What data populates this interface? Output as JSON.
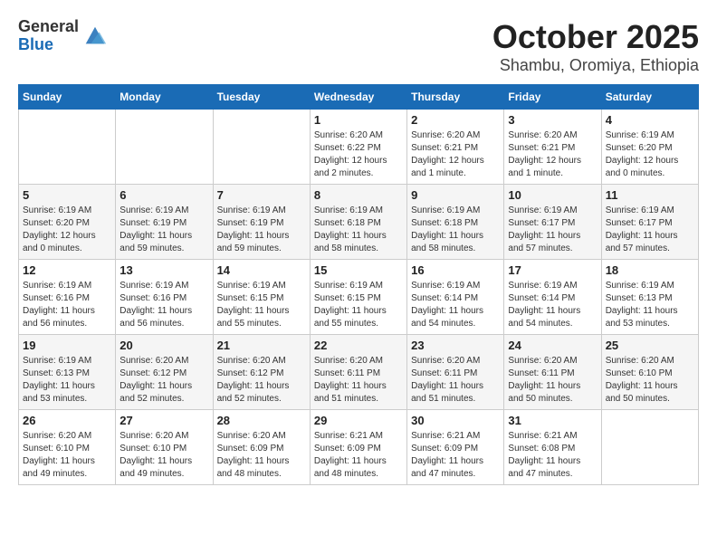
{
  "header": {
    "logo_general": "General",
    "logo_blue": "Blue",
    "month": "October 2025",
    "location": "Shambu, Oromiya, Ethiopia"
  },
  "weekdays": [
    "Sunday",
    "Monday",
    "Tuesday",
    "Wednesday",
    "Thursday",
    "Friday",
    "Saturday"
  ],
  "weeks": [
    [
      {
        "day": "",
        "info": ""
      },
      {
        "day": "",
        "info": ""
      },
      {
        "day": "",
        "info": ""
      },
      {
        "day": "1",
        "info": "Sunrise: 6:20 AM\nSunset: 6:22 PM\nDaylight: 12 hours and 2 minutes."
      },
      {
        "day": "2",
        "info": "Sunrise: 6:20 AM\nSunset: 6:21 PM\nDaylight: 12 hours and 1 minute."
      },
      {
        "day": "3",
        "info": "Sunrise: 6:20 AM\nSunset: 6:21 PM\nDaylight: 12 hours and 1 minute."
      },
      {
        "day": "4",
        "info": "Sunrise: 6:19 AM\nSunset: 6:20 PM\nDaylight: 12 hours and 0 minutes."
      }
    ],
    [
      {
        "day": "5",
        "info": "Sunrise: 6:19 AM\nSunset: 6:20 PM\nDaylight: 12 hours and 0 minutes."
      },
      {
        "day": "6",
        "info": "Sunrise: 6:19 AM\nSunset: 6:19 PM\nDaylight: 11 hours and 59 minutes."
      },
      {
        "day": "7",
        "info": "Sunrise: 6:19 AM\nSunset: 6:19 PM\nDaylight: 11 hours and 59 minutes."
      },
      {
        "day": "8",
        "info": "Sunrise: 6:19 AM\nSunset: 6:18 PM\nDaylight: 11 hours and 58 minutes."
      },
      {
        "day": "9",
        "info": "Sunrise: 6:19 AM\nSunset: 6:18 PM\nDaylight: 11 hours and 58 minutes."
      },
      {
        "day": "10",
        "info": "Sunrise: 6:19 AM\nSunset: 6:17 PM\nDaylight: 11 hours and 57 minutes."
      },
      {
        "day": "11",
        "info": "Sunrise: 6:19 AM\nSunset: 6:17 PM\nDaylight: 11 hours and 57 minutes."
      }
    ],
    [
      {
        "day": "12",
        "info": "Sunrise: 6:19 AM\nSunset: 6:16 PM\nDaylight: 11 hours and 56 minutes."
      },
      {
        "day": "13",
        "info": "Sunrise: 6:19 AM\nSunset: 6:16 PM\nDaylight: 11 hours and 56 minutes."
      },
      {
        "day": "14",
        "info": "Sunrise: 6:19 AM\nSunset: 6:15 PM\nDaylight: 11 hours and 55 minutes."
      },
      {
        "day": "15",
        "info": "Sunrise: 6:19 AM\nSunset: 6:15 PM\nDaylight: 11 hours and 55 minutes."
      },
      {
        "day": "16",
        "info": "Sunrise: 6:19 AM\nSunset: 6:14 PM\nDaylight: 11 hours and 54 minutes."
      },
      {
        "day": "17",
        "info": "Sunrise: 6:19 AM\nSunset: 6:14 PM\nDaylight: 11 hours and 54 minutes."
      },
      {
        "day": "18",
        "info": "Sunrise: 6:19 AM\nSunset: 6:13 PM\nDaylight: 11 hours and 53 minutes."
      }
    ],
    [
      {
        "day": "19",
        "info": "Sunrise: 6:19 AM\nSunset: 6:13 PM\nDaylight: 11 hours and 53 minutes."
      },
      {
        "day": "20",
        "info": "Sunrise: 6:20 AM\nSunset: 6:12 PM\nDaylight: 11 hours and 52 minutes."
      },
      {
        "day": "21",
        "info": "Sunrise: 6:20 AM\nSunset: 6:12 PM\nDaylight: 11 hours and 52 minutes."
      },
      {
        "day": "22",
        "info": "Sunrise: 6:20 AM\nSunset: 6:11 PM\nDaylight: 11 hours and 51 minutes."
      },
      {
        "day": "23",
        "info": "Sunrise: 6:20 AM\nSunset: 6:11 PM\nDaylight: 11 hours and 51 minutes."
      },
      {
        "day": "24",
        "info": "Sunrise: 6:20 AM\nSunset: 6:11 PM\nDaylight: 11 hours and 50 minutes."
      },
      {
        "day": "25",
        "info": "Sunrise: 6:20 AM\nSunset: 6:10 PM\nDaylight: 11 hours and 50 minutes."
      }
    ],
    [
      {
        "day": "26",
        "info": "Sunrise: 6:20 AM\nSunset: 6:10 PM\nDaylight: 11 hours and 49 minutes."
      },
      {
        "day": "27",
        "info": "Sunrise: 6:20 AM\nSunset: 6:10 PM\nDaylight: 11 hours and 49 minutes."
      },
      {
        "day": "28",
        "info": "Sunrise: 6:20 AM\nSunset: 6:09 PM\nDaylight: 11 hours and 48 minutes."
      },
      {
        "day": "29",
        "info": "Sunrise: 6:21 AM\nSunset: 6:09 PM\nDaylight: 11 hours and 48 minutes."
      },
      {
        "day": "30",
        "info": "Sunrise: 6:21 AM\nSunset: 6:09 PM\nDaylight: 11 hours and 47 minutes."
      },
      {
        "day": "31",
        "info": "Sunrise: 6:21 AM\nSunset: 6:08 PM\nDaylight: 11 hours and 47 minutes."
      },
      {
        "day": "",
        "info": ""
      }
    ]
  ]
}
